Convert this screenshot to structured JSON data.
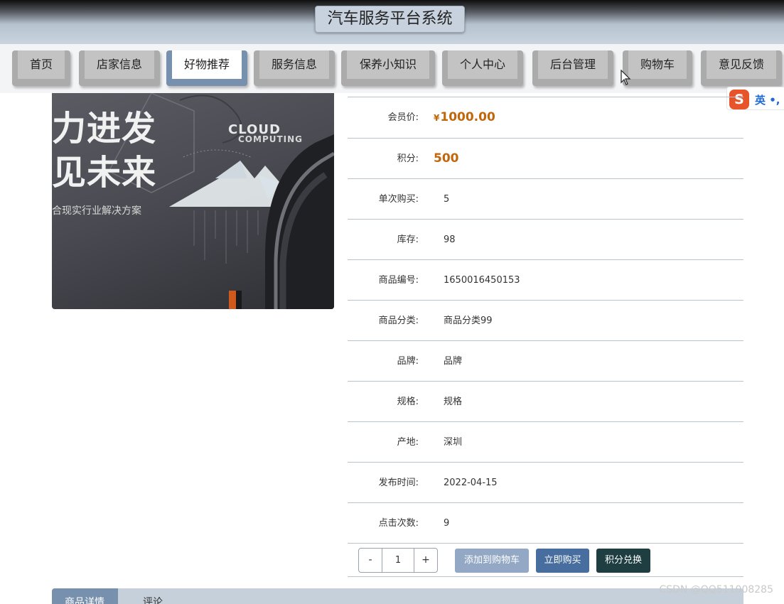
{
  "header": {
    "title": "汽车服务平台系统"
  },
  "nav": {
    "items": [
      {
        "label": "首页"
      },
      {
        "label": "店家信息"
      },
      {
        "label": "好物推荐",
        "active": true
      },
      {
        "label": "服务信息"
      },
      {
        "label": "保养小知识"
      },
      {
        "label": "个人中心"
      },
      {
        "label": "后台管理"
      },
      {
        "label": "购物车"
      },
      {
        "label": "意见反馈"
      }
    ]
  },
  "ime": {
    "logo": "S",
    "text": "英 •,"
  },
  "product_image": {
    "line1": "力进发",
    "line2": "见未来",
    "line3": "合现实行业解决方案",
    "cloud": "CLOUD",
    "computing": "COMPUTING"
  },
  "details": {
    "member_price": {
      "label": "会员价:",
      "currency": "¥",
      "value": "1000.00"
    },
    "points": {
      "label": "积分:",
      "value": "500"
    },
    "single_purchase": {
      "label": "单次购买:",
      "value": "5"
    },
    "stock": {
      "label": "库存:",
      "value": "98"
    },
    "product_code": {
      "label": "商品编号:",
      "value": "1650016450153"
    },
    "category": {
      "label": "商品分类:",
      "value": "商品分类99"
    },
    "brand": {
      "label": "品牌:",
      "value": "品牌"
    },
    "spec": {
      "label": "规格:",
      "value": "规格"
    },
    "origin": {
      "label": "产地:",
      "value": "深圳"
    },
    "publish_time": {
      "label": "发布时间:",
      "value": "2022-04-15"
    },
    "clicks": {
      "label": "点击次数:",
      "value": "9"
    }
  },
  "actions": {
    "minus": "-",
    "quantity": "1",
    "plus": "+",
    "add_to_cart": "添加到购物车",
    "buy_now": "立即购买",
    "redeem_points": "积分兑换"
  },
  "tabs": [
    {
      "label": "商品详情",
      "active": true
    },
    {
      "label": "评论"
    }
  ],
  "watermark": "CSDN @QQ511008285",
  "colors": {
    "accent": "#7790ad",
    "price": "#c0670b",
    "buy_button": "#476e9e",
    "points_button": "#1e3e41",
    "cart_button": "#93a8c4"
  }
}
